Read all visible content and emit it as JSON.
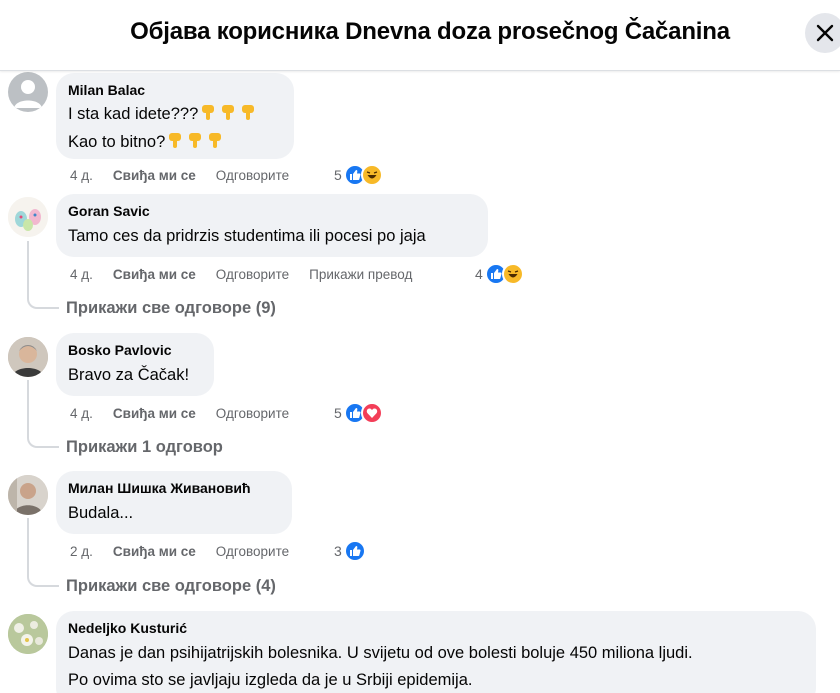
{
  "header": {
    "title": "Објава корисника Dnevna doza prosečnog Čačanina"
  },
  "labels": {
    "like": "Свиђа ми се",
    "reply": "Одговорите",
    "translate": "Прикажи превод"
  },
  "comments": [
    {
      "author": "Milan Balac",
      "lines": [
        "I sta kad idete???",
        "Kao to bitno?"
      ],
      "age": "4 д.",
      "reaction_count": "5",
      "reactions": [
        "like-icon",
        "haha-icon"
      ],
      "line_emoji": "thumbs-down-icon"
    },
    {
      "author": "Goran Savic",
      "lines": [
        "Tamo ces da pridrzis studentima ili pocesi po jaja"
      ],
      "age": "4 д.",
      "reaction_count": "4",
      "reactions": [
        "like-icon",
        "haha-icon"
      ],
      "replies_label": "Прикажи све одговоре (9)"
    },
    {
      "author": "Bosko Pavlovic",
      "lines": [
        "Bravo za Čačak!"
      ],
      "age": "4 д.",
      "reaction_count": "5",
      "reactions": [
        "like-icon",
        "love-icon"
      ],
      "replies_label": "Прикажи 1 одговор"
    },
    {
      "author": "Милан Шишка Живановић",
      "lines": [
        "Budala..."
      ],
      "age": "2 д.",
      "reaction_count": "3",
      "reactions": [
        "like-icon"
      ],
      "replies_label": "Прикажи све одговоре (4)"
    },
    {
      "author": "Nedeljko Kusturić",
      "lines": [
        "Danas je dan psihijatrijskih bolesnika. U svijetu od ove bolesti boluje 450 miliona ljudi.",
        "Po ovima sto se javljaju izgleda da je u Srbiji epidemija."
      ]
    }
  ],
  "colors": {
    "like_blue": "#1877f2",
    "love_red": "#f33e58",
    "haha_yellow": "#f7b928",
    "bubble": "#f0f2f5",
    "secondary_text": "#65676b"
  }
}
